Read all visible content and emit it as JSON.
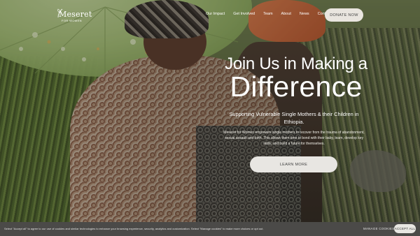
{
  "brand": {
    "name": "Meseret",
    "tagline": "FOR WOMEN"
  },
  "nav": {
    "items": [
      "Our Impact",
      "Get Involved",
      "Team",
      "About",
      "News",
      "Contact"
    ],
    "donate_label": "DONATE NOW"
  },
  "hero": {
    "headline_line1": "Join Us in Making a",
    "headline_line2": "Difference",
    "subheading": "Supporting Vulnerable Single Mothers & their Children in Ethiopia.",
    "description": "Meseret for Women empowers single mothers to recover from the trauma of abandonment, sexual assault and birth. This allows them time to bond with their baby, learn, develop key skills, and build a future for themselves.",
    "cta_label": "LEARN MORE"
  },
  "cookie_bar": {
    "text": "Select \"Accept all\" to agree to our use of cookies and similar technologies to enhance your browsing experience, security, analytics and customization. Select \"Manage cookies\" to make more choices or opt out.",
    "manage_label": "MANAGE COOKIES",
    "accept_label": "ACCEPT ALL"
  },
  "colors": {
    "button_bg": "#e8e6e2",
    "cookie_bg": "#4b4a48",
    "text": "#ffffff"
  }
}
